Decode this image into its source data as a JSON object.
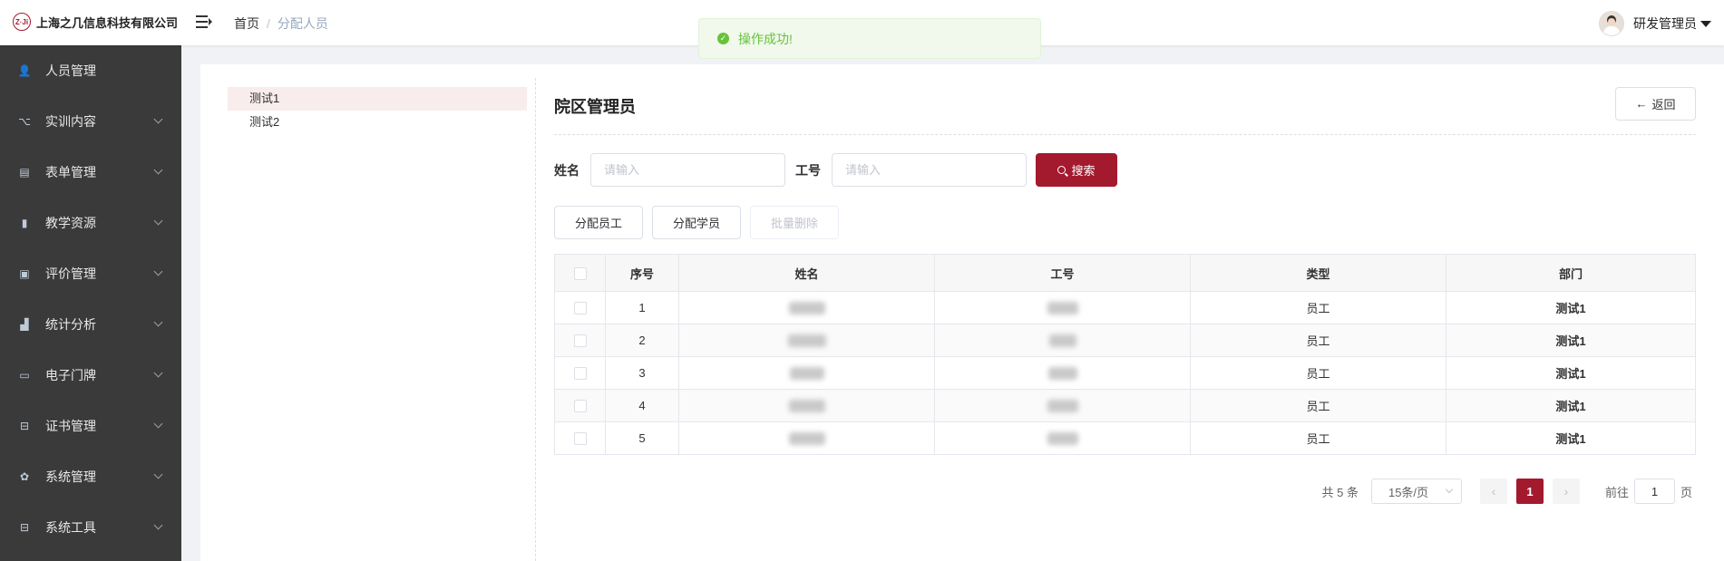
{
  "header": {
    "logo_mark": "Z·Ji",
    "company": "上海之几信息科技有限公司",
    "breadcrumb": {
      "home": "首页",
      "separator": "/",
      "current": "分配人员"
    },
    "user_name": "研发管理员"
  },
  "toast": {
    "message": "操作成功!",
    "type": "success"
  },
  "sidebar": {
    "items": [
      {
        "label": "人员管理",
        "icon": "user-icon",
        "glyph": "👤"
      },
      {
        "label": "实训内容",
        "icon": "tree-icon",
        "glyph": "⌥"
      },
      {
        "label": "表单管理",
        "icon": "form-icon",
        "glyph": "▤"
      },
      {
        "label": "教学资源",
        "icon": "book-icon",
        "glyph": "▮"
      },
      {
        "label": "评价管理",
        "icon": "image-icon",
        "glyph": "▣"
      },
      {
        "label": "统计分析",
        "icon": "bar-chart-icon",
        "glyph": "▟"
      },
      {
        "label": "电子门牌",
        "icon": "monitor-icon",
        "glyph": "▭"
      },
      {
        "label": "证书管理",
        "icon": "briefcase-icon",
        "glyph": "⊟"
      },
      {
        "label": "系统管理",
        "icon": "gear-icon",
        "glyph": "✿"
      },
      {
        "label": "系统工具",
        "icon": "toolbox-icon",
        "glyph": "⊟"
      }
    ]
  },
  "tree": {
    "items": [
      "测试1",
      "测试2"
    ],
    "selected": "测试1"
  },
  "panel": {
    "title": "院区管理员",
    "back_label": "返回",
    "search": {
      "name_label": "姓名",
      "name_placeholder": "请输入",
      "id_label": "工号",
      "id_placeholder": "请输入",
      "button_label": "搜索"
    },
    "actions": {
      "assign_staff": "分配员工",
      "assign_student": "分配学员",
      "batch_delete": "批量删除"
    }
  },
  "table": {
    "headers": [
      "序号",
      "姓名",
      "工号",
      "类型",
      "部门"
    ],
    "rows": [
      {
        "index": "1",
        "type": "员工",
        "dept": "测试1"
      },
      {
        "index": "2",
        "type": "员工",
        "dept": "测试1"
      },
      {
        "index": "3",
        "type": "员工",
        "dept": "测试1"
      },
      {
        "index": "4",
        "type": "员工",
        "dept": "测试1"
      },
      {
        "index": "5",
        "type": "员工",
        "dept": "测试1"
      }
    ]
  },
  "pagination": {
    "total_text": "共 5 条",
    "page_size": "15条/页",
    "current_page": "1",
    "goto_label": "前往",
    "goto_value": "1",
    "page_suffix": "页"
  },
  "colors": {
    "accent": "#a3192e",
    "sidebar_bg": "#3a3a3a",
    "success": "#67c23a"
  }
}
